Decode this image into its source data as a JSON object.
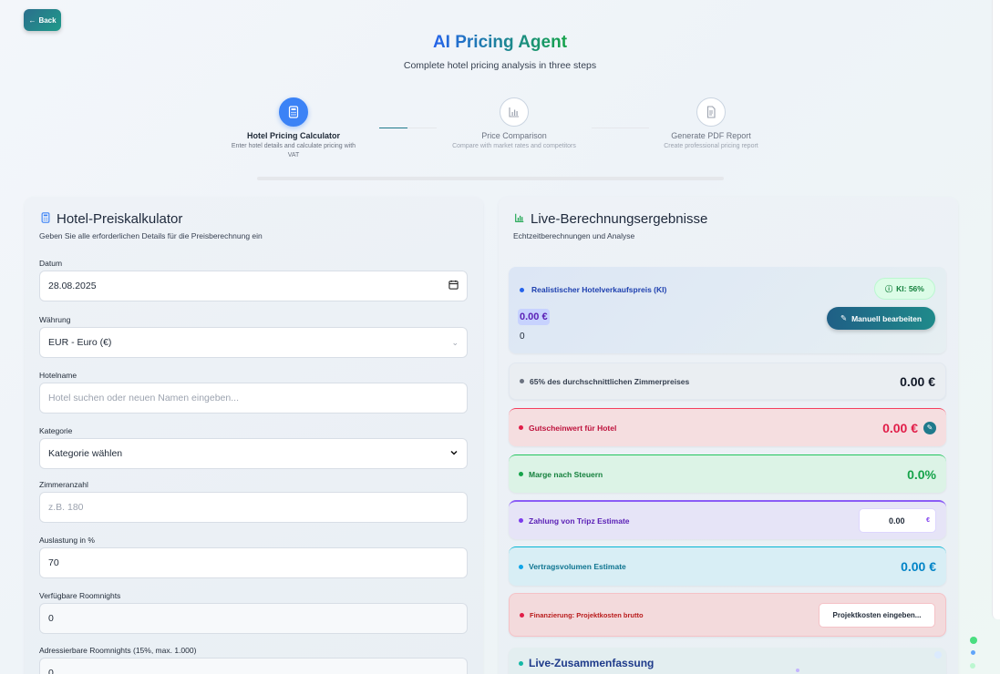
{
  "nav": {
    "back_label": "Back"
  },
  "header": {
    "title": "AI Pricing Agent",
    "subtitle": "Complete hotel pricing analysis in three steps"
  },
  "steps": [
    {
      "title": "Hotel Pricing Calculator",
      "desc": "Enter hotel details and calculate pricing with VAT",
      "icon": "calculator-icon",
      "active": true
    },
    {
      "title": "Price Comparison",
      "desc": "Compare with market rates and competitors",
      "icon": "bar-chart-icon",
      "active": false
    },
    {
      "title": "Generate PDF Report",
      "desc": "Create professional pricing report",
      "icon": "document-icon",
      "active": false
    }
  ],
  "calculator": {
    "title": "Hotel-Preiskalkulator",
    "subtitle": "Geben Sie alle erforderlichen Details für die Preisberechnung ein",
    "fields": {
      "datum": {
        "label": "Datum",
        "value": "28.08.2025"
      },
      "waehrung": {
        "label": "Währung",
        "value": "EUR - Euro (€)"
      },
      "hotelname": {
        "label": "Hotelname",
        "placeholder": "Hotel suchen oder neuen Namen eingeben..."
      },
      "kategorie": {
        "label": "Kategorie",
        "value": "Kategorie wählen"
      },
      "zimmeranzahl": {
        "label": "Zimmeranzahl",
        "placeholder": "z.B. 180"
      },
      "auslastung": {
        "label": "Auslastung in %",
        "value": "70"
      },
      "verfuegbare": {
        "label": "Verfügbare Roomnights",
        "value": "0"
      },
      "adressierbare": {
        "label": "Adressierbare Roomnights (15%, max. 1.000)",
        "value": "0"
      }
    }
  },
  "results": {
    "title": "Live-Berechnungsergebnisse",
    "subtitle": "Echtzeitberechnungen und Analyse",
    "ai_card": {
      "label": "Realistischer Hotelverkaufspreis (KI)",
      "ki_badge": "KI: 56%",
      "value": "0.00 €",
      "sub_value": "0",
      "edit_label": "Manuell bearbeiten"
    },
    "avg_card": {
      "label": "65% des durchschnittlichen Zimmerpreises",
      "value": "0.00 €"
    },
    "voucher_card": {
      "label": "Gutscheinwert für Hotel",
      "value": "0.00 €"
    },
    "margin_card": {
      "label": "Marge nach Steuern",
      "value": "0.0%"
    },
    "tripz_card": {
      "label": "Zahlung von Tripz Estimate",
      "input_value": "0.00",
      "currency": "€"
    },
    "contract_card": {
      "label": "Vertragsvolumen Estimate",
      "value": "0.00 €"
    },
    "financing_card": {
      "label": "Finanzierung: Projektkosten brutto",
      "button_label": "Projektkosten eingeben..."
    },
    "summary": {
      "title": "Live-Zusammenfassung"
    }
  },
  "colors": {
    "accent_blue": "#3b82f6",
    "teal": "#1f7a8c",
    "red": "#e11d48",
    "green": "#16a34a",
    "purple": "#7c3aed",
    "cyan": "#0284c7"
  }
}
